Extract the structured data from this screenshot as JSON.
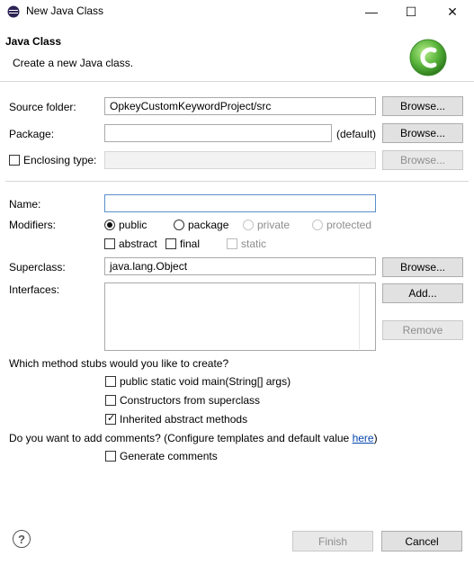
{
  "window": {
    "title": "New Java Class",
    "minimize_icon": "—",
    "maximize_icon": "☐",
    "close_icon": "✕"
  },
  "header": {
    "title": "Java Class",
    "subtitle": "Create a new Java class.",
    "image_letter": "C"
  },
  "source_folder": {
    "label": "Source folder:",
    "value": "OpkeyCustomKeywordProject/src",
    "browse": "Browse..."
  },
  "package": {
    "label": "Package:",
    "value": "",
    "suffix": "(default)",
    "browse": "Browse..."
  },
  "enclosing": {
    "label": "Enclosing type:",
    "value": "",
    "checked": false,
    "browse": "Browse..."
  },
  "name": {
    "label": "Name:",
    "value": ""
  },
  "modifiers": {
    "label": "Modifiers:",
    "public": "public",
    "package": "package",
    "private": "private",
    "protected": "protected",
    "selected": "public",
    "abstract": "abstract",
    "final": "final",
    "static": "static"
  },
  "superclass": {
    "label": "Superclass:",
    "value": "java.lang.Object",
    "browse": "Browse..."
  },
  "interfaces": {
    "label": "Interfaces:",
    "add": "Add...",
    "remove": "Remove"
  },
  "stubs": {
    "question": "Which method stubs would you like to create?",
    "main": "public static void main(String[] args)",
    "constructors": "Constructors from superclass",
    "inherited": "Inherited abstract methods",
    "main_checked": false,
    "constructors_checked": false,
    "inherited_checked": true
  },
  "comments": {
    "question": "Do you want to add comments? (Configure templates and default value ",
    "link": "here",
    "close": ")",
    "generate": "Generate comments",
    "generate_checked": false
  },
  "footer": {
    "help_icon": "?",
    "finish": "Finish",
    "cancel": "Cancel"
  },
  "colors": {
    "accent": "#5a8fc8",
    "link": "#0645ad",
    "logo_green": "#58b33a"
  }
}
